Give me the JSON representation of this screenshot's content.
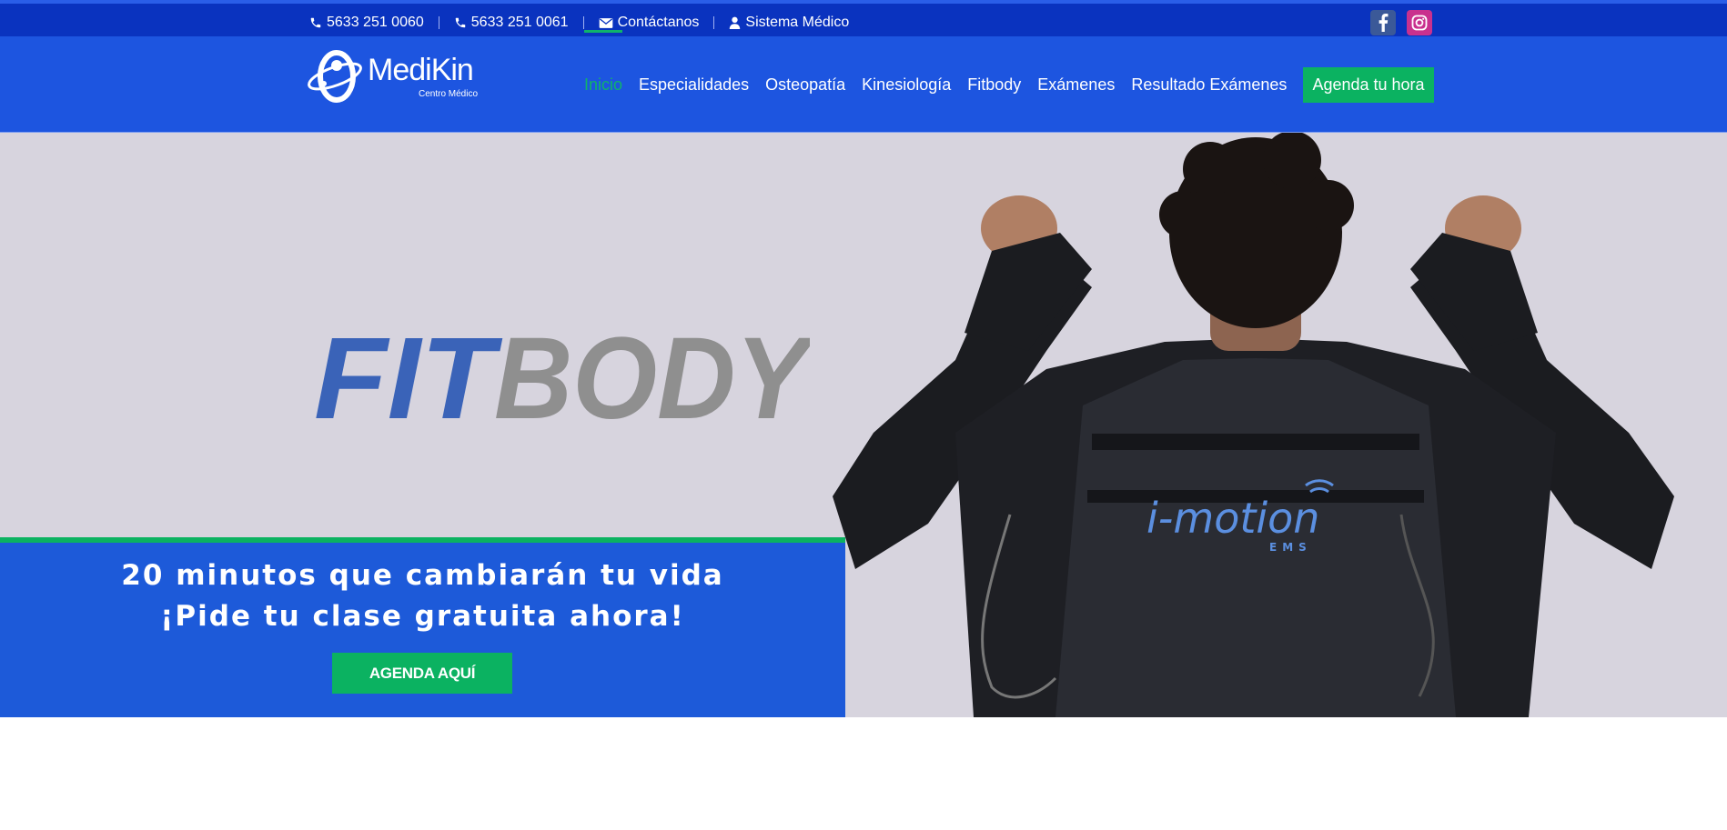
{
  "topbar": {
    "phone1": "5633 251 0060",
    "phone2": "5633 251 0061",
    "contact": "Contáctanos",
    "system": "Sistema Médico",
    "icons": {
      "phone": "phone-icon",
      "mail": "envelope-icon",
      "user": "user-icon",
      "facebook": "facebook-icon",
      "instagram": "instagram-icon"
    }
  },
  "logo": {
    "name": "MediKin",
    "tagline": "Centro Médico"
  },
  "nav": {
    "items": [
      "Inicio",
      "Especialidades",
      "Osteopatía",
      "Kinesiología",
      "Fitbody",
      "Exámenes",
      "Resultado Exámenes"
    ],
    "active": "Inicio",
    "cta": "Agenda tu hora"
  },
  "hero": {
    "brand_part1": "FIT",
    "brand_part2": "BODY",
    "vest_brand": "i-motion",
    "vest_sub": "EMS",
    "promo_line1": "20 minutos que cambiarán tu vida",
    "promo_line2": "¡Pide tu clase gratuita ahora!",
    "button": "AGENDA AQUÍ"
  },
  "colors": {
    "topbar": "#0a33bf",
    "header": "#1d55e0",
    "accent_green": "#0bb261",
    "hero_bg": "#d7d4de",
    "fit_blue": "#3a63b8",
    "body_gray": "#8f8f8f"
  }
}
